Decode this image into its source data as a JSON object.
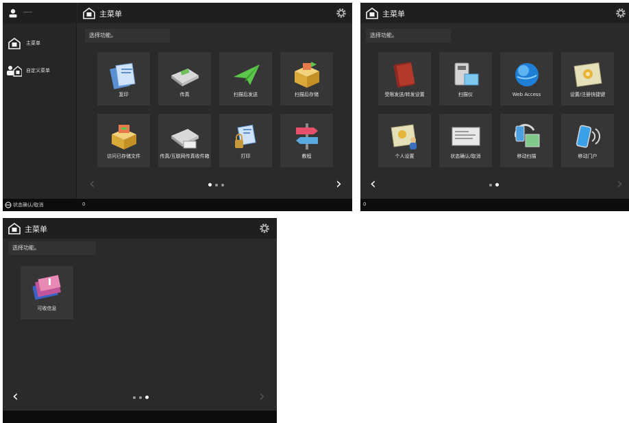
{
  "panel1": {
    "user_label": "-----",
    "sidebar_items": [
      {
        "label": "主菜单",
        "icon": "home-icon"
      },
      {
        "label": "自定义菜单",
        "icon": "custom-menu-icon"
      }
    ],
    "title": "主菜单",
    "prompt": "选择功能。",
    "tiles": [
      {
        "label": "复印",
        "icon": "copy-icon"
      },
      {
        "label": "传真",
        "icon": "fax-icon"
      },
      {
        "label": "扫描后发送",
        "icon": "scan-send-icon"
      },
      {
        "label": "扫描后存储",
        "icon": "scan-store-icon"
      },
      {
        "label": "访问已存储文件",
        "icon": "stored-files-icon"
      },
      {
        "label": "传真/互联网传真收件箱",
        "icon": "fax-inbox-icon"
      },
      {
        "label": "打印",
        "icon": "print-icon"
      },
      {
        "label": "教程",
        "icon": "tutorial-icon"
      }
    ],
    "status_text": "状态确认/取消",
    "status_code": "0"
  },
  "panel2": {
    "title": "主菜单",
    "prompt": "选择功能。",
    "tiles": [
      {
        "label": "受限发送/转发设置",
        "icon": "address-book-icon"
      },
      {
        "label": "扫描仪",
        "icon": "scanner-icon"
      },
      {
        "label": "Web Access",
        "icon": "web-access-icon"
      },
      {
        "label": "设置/注册快捷键",
        "icon": "settings-shortcut-icon"
      },
      {
        "label": "个人设置",
        "icon": "personal-settings-icon"
      },
      {
        "label": "状态确认/取消",
        "icon": "status-monitor-icon"
      },
      {
        "label": "移动扫描",
        "icon": "mobile-scan-icon"
      },
      {
        "label": "移动门户",
        "icon": "mobile-portal-icon"
      }
    ],
    "status_code": "0"
  },
  "panel3": {
    "title": "主菜单",
    "prompt": "选择功能。",
    "tiles": [
      {
        "label": "可收信息",
        "icon": "info-icon"
      }
    ]
  },
  "colors": {
    "screen_bg": "#2a2a2a",
    "tile_bg": "#363636",
    "statusbar_bg": "#0c0c0c"
  }
}
